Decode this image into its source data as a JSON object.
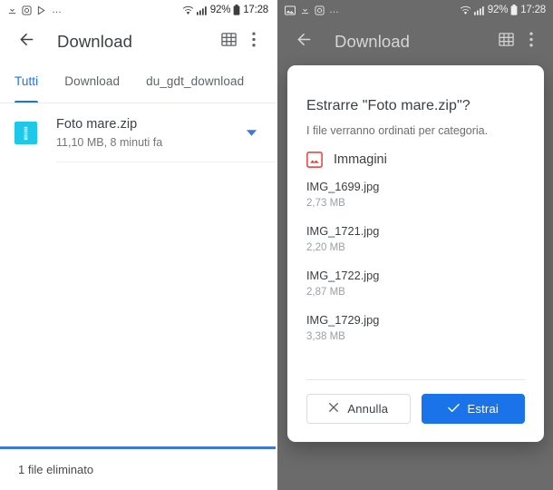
{
  "left_screen": {
    "status_bar": {
      "icons": [
        "download-icon",
        "camera-icon",
        "play-icon"
      ],
      "overflow": "…",
      "wifi": "wifi-icon",
      "signal": "signal-icon",
      "battery_percent": "92%",
      "battery": "battery-icon",
      "time": "17:28"
    },
    "toolbar": {
      "back": "arrow-back-icon",
      "title": "Download",
      "grid": "grid-view-icon",
      "menu": "more-vert-icon"
    },
    "tabs": [
      {
        "label": "Tutti",
        "active": true
      },
      {
        "label": "Download",
        "active": false
      },
      {
        "label": "du_gdt_download",
        "active": false
      }
    ],
    "file": {
      "icon": "zip-file-icon",
      "name": "Foto mare.zip",
      "subtitle": "11,10 MB, 8 minuti fa",
      "caret": "chevron-down-icon"
    },
    "bottom_status": "1 file eliminato"
  },
  "right_screen": {
    "status_bar": {
      "icons": [
        "image-icon",
        "download-icon",
        "camera-icon"
      ],
      "overflow": "…",
      "wifi": "wifi-icon",
      "signal": "signal-icon",
      "battery_percent": "92%",
      "battery": "battery-icon",
      "time": "17:28"
    },
    "toolbar": {
      "back": "arrow-back-icon",
      "title": "Download",
      "grid": "grid-view-icon",
      "menu": "more-vert-icon"
    },
    "dialog": {
      "title": "Estrarre \"Foto mare.zip\"?",
      "subtitle": "I file verranno ordinati per categoria.",
      "category": {
        "icon": "image-category-icon",
        "label": "Immagini"
      },
      "files": [
        {
          "name": "IMG_1699.jpg",
          "size": "2,73 MB"
        },
        {
          "name": "IMG_1721.jpg",
          "size": "2,20 MB"
        },
        {
          "name": "IMG_1722.jpg",
          "size": "2,87 MB"
        },
        {
          "name": "IMG_1729.jpg",
          "size": "3,38 MB"
        }
      ],
      "cancel_button": {
        "label": "Annulla",
        "icon": "close-icon"
      },
      "extract_button": {
        "label": "Estrai",
        "icon": "check-icon"
      }
    }
  },
  "colors": {
    "accent_blue": "#1a73e8",
    "progress_blue": "#3b78d8",
    "zip_cyan": "#1ec8e8",
    "category_red": "#e53935",
    "scrim": "#6b6b6b"
  }
}
